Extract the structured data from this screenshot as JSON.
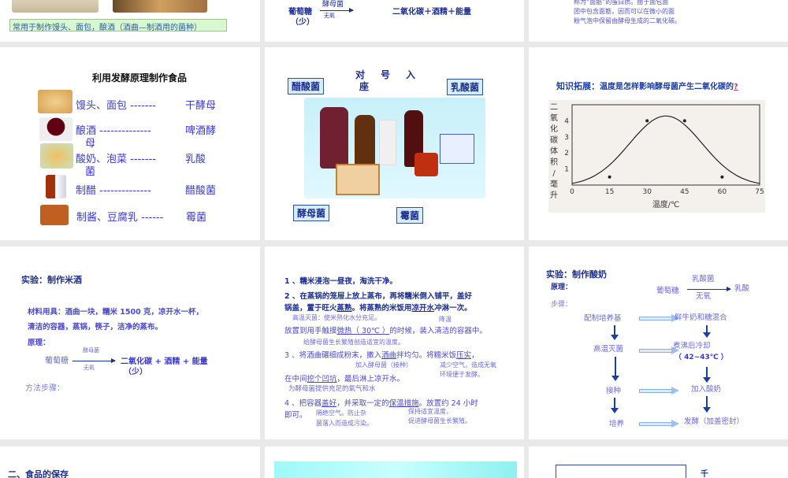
{
  "slides": {
    "s1": {
      "caption": "常用于制作馒头、面包，酿酒（酒曲—制酒用的菌种）"
    },
    "s2": {
      "reactant": "葡萄糖",
      "reactant_note": "（少）",
      "above": "酵母菌",
      "below": "无氧",
      "product": "二氧化碳＋酒精＋能量"
    },
    "s3": {
      "lines": [
        "称为“面筋”的蛋白质。由于面包面",
        "团中包含面筋，因而可以在微小的面",
        "粉气泡中保留由酵母生成的二氧化碳。"
      ]
    },
    "s4": {
      "title": "利用发酵原理制作食品",
      "rows": [
        {
          "food": "馒头、面包 -------",
          "microbe": "干酵母",
          "icon": "bread-icon"
        },
        {
          "food": "酿酒 --------------",
          "microbe": "啤酒酵",
          "extra": "母",
          "icon": "wine-glass-icon"
        },
        {
          "food": "酸奶、泡菜 -------",
          "microbe": "乳酸",
          "extra": "菌",
          "icon": "pickle-icon"
        },
        {
          "food": "制醋 --------------",
          "microbe": "醋酸菌",
          "icon": "vinegar-bottle-icon"
        },
        {
          "food": "制酱、豆腐乳 ------",
          "microbe": "霉菌",
          "icon": "sauce-jar-icon"
        }
      ]
    },
    "s5": {
      "title_line1": "对　号　入",
      "title_line2": "座",
      "labels": {
        "acetic": "醋酸菌",
        "lactic": "乳酸菌",
        "yeast": "酵母菌",
        "mold": "霉菌"
      }
    },
    "s6": {
      "heading_label": "知识拓展：",
      "heading": "温度是怎样影响酵母菌产生二氧化碳的",
      "question_mark": "?"
    },
    "s7": {
      "title": "实验：制作米酒",
      "materials_1": "材料用具：酒曲一块，糯米 1500 克，凉开水一杯，",
      "materials_2": "清洁的容器，蒸锅，筷子，洁净的蒸布。",
      "principle": "原理：",
      "reactant": "葡萄糖",
      "above": "酵母菌",
      "below": "无氧",
      "product": "二氧化碳 + 酒精 + 能量",
      "product_note": "（少）",
      "steps": "方法步骤："
    },
    "s8": {
      "l1": "1 、糯米浸泡一昼夜，淘洗干净。",
      "l2a": "2 、在蒸锅的笼屉上放上蒸布，再将糯米倒入铺平，盖好",
      "l2b_1": "锅盖，置于旺火",
      "l2b_u1": "蒸熟",
      "l2b_2": "。将蒸熟的米饭用",
      "l2b_u2": "凉开水",
      "l2b_3": "冲淋一次。",
      "n1": "高温灭菌：使米熟化水分充足。",
      "n2": "降温",
      "l3_1": "放置到用手触摸",
      "l3_u": "微热（ 30℃ ）",
      "l3_2": "的时候，装入清洁的容器中。",
      "n3": "给酵母菌生长繁殖创造适宜的温度。",
      "l4_1": "3 、将酒曲碾细成粉末，撒入",
      "l4_u1": "酒曲",
      "l4_2": "拌均匀。将糯米饭",
      "l4_u2": "压实",
      "l4_3": "，",
      "n4": "加入酵母菌（接种）",
      "n5a": "减少空气，造成无氧",
      "n5b": "环境便于发酵。",
      "l5_1": "在中间",
      "l5_u": "挖个凹坑",
      "l5_2": "，最后淋上凉开水。",
      "n6": "为酵母菌提供充足的氧气和水",
      "l6_1": "4 、把容器",
      "l6_u1": "盖好",
      "l6_2": "，并采取一定的",
      "l6_u2": "保温措施",
      "l6_3": "。放置约 24 小时",
      "l7": "即可。",
      "n7a": "隔绝空气。防止杂",
      "n7b": "菌落入而造成污染。",
      "n8a": "保持适宜温度，",
      "n8b": "促进酵母菌生长繁殖。"
    },
    "s9": {
      "title": "实验：制作酸奶",
      "principle": "原理：",
      "reactant": "葡萄糖",
      "above": "乳酸菌",
      "below": "无氧",
      "product": "乳酸",
      "steps_label": "步骤：",
      "left": [
        "配制培养基",
        "高温灭菌",
        "接种",
        "培养"
      ],
      "right": [
        "鲜牛奶和糖混合",
        "煮沸后冷却",
        "（ 42~43℃ ）",
        "加入酸奶",
        "发酵（加盖密封）"
      ]
    },
    "s10": {
      "title": "二、食品的保存"
    },
    "s12": {
      "text": "千"
    }
  },
  "chart_data": {
    "type": "line",
    "xlabel": "温度/℃",
    "ylabel": "二氧化碳体积/毫升",
    "ylabel_chars": [
      "二",
      "氧",
      "化",
      "碳",
      "体",
      "积",
      "/",
      "毫",
      "升"
    ],
    "xticks": [
      0,
      15,
      30,
      45,
      60,
      75
    ],
    "yticks": [
      1,
      2,
      3,
      4
    ],
    "xlim": [
      0,
      75
    ],
    "ylim": [
      0,
      5
    ],
    "points": [
      [
        0,
        0
      ],
      [
        15,
        0.5
      ],
      [
        30,
        4
      ],
      [
        37.5,
        4.35
      ],
      [
        45,
        4
      ],
      [
        60,
        0.5
      ],
      [
        75,
        0
      ]
    ],
    "marked": [
      [
        15,
        0.5
      ],
      [
        30,
        4
      ],
      [
        45,
        4
      ],
      [
        60,
        0.5
      ]
    ]
  }
}
